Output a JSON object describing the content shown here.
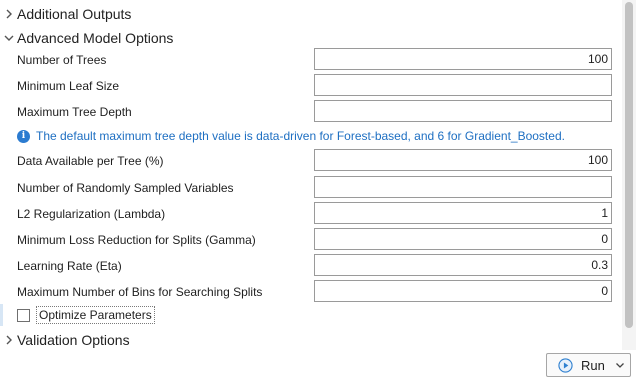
{
  "sections": {
    "additional_outputs": "Additional Outputs",
    "advanced_model_options": "Advanced Model Options",
    "validation_options": "Validation Options"
  },
  "parameters": [
    {
      "label": "Number of Trees",
      "value": "100"
    },
    {
      "label": "Minimum Leaf Size",
      "value": ""
    },
    {
      "label": "Maximum Tree Depth",
      "value": ""
    },
    {
      "label": "Data Available per Tree (%)",
      "value": "100"
    },
    {
      "label": "Number of Randomly Sampled Variables",
      "value": ""
    },
    {
      "label": "L2 Regularization (Lambda)",
      "value": "1"
    },
    {
      "label": "Minimum Loss Reduction for Splits (Gamma)",
      "value": "0"
    },
    {
      "label": "Learning Rate (Eta)",
      "value": "0.3"
    },
    {
      "label": "Maximum Number of Bins for Searching Splits",
      "value": "0"
    }
  ],
  "info_message": "The default maximum tree depth value is data-driven for Forest-based, and 6 for Gradient_Boosted.",
  "optimize_parameters": {
    "label": "Optimize Parameters",
    "checked": false
  },
  "run_button": {
    "label": "Run"
  },
  "colors": {
    "info_text": "#1e6fc2",
    "info_icon": "#2b7bd0",
    "run_icon": "#2f80d0"
  }
}
